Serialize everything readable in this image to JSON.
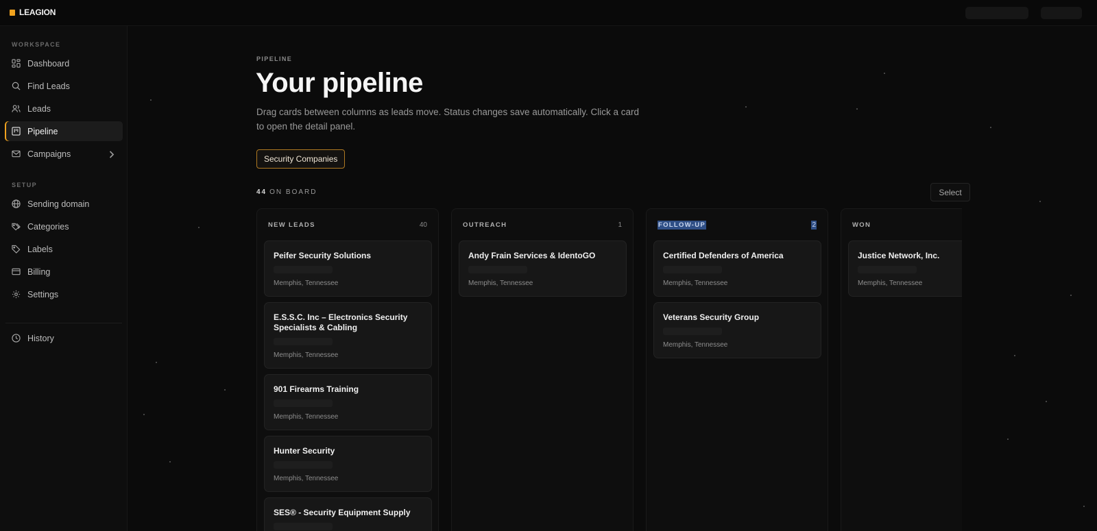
{
  "app": {
    "name": "LEAGION"
  },
  "sidebar": {
    "sections": [
      {
        "label": "WORKSPACE"
      },
      {
        "label": "SETUP"
      }
    ],
    "items": [
      {
        "label": "Dashboard",
        "icon": "grid-icon"
      },
      {
        "label": "Find Leads",
        "icon": "search-icon"
      },
      {
        "label": "Leads",
        "icon": "users-icon"
      },
      {
        "label": "Pipeline",
        "icon": "kanban-icon",
        "active": true
      },
      {
        "label": "Campaigns",
        "icon": "mail-icon"
      },
      {
        "label": "Sending domain",
        "icon": "globe-icon"
      },
      {
        "label": "Categories",
        "icon": "tags-icon"
      },
      {
        "label": "Labels",
        "icon": "tag-icon"
      },
      {
        "label": "Billing",
        "icon": "card-icon"
      },
      {
        "label": "Settings",
        "icon": "gear-icon"
      },
      {
        "label": "History",
        "icon": "clock-icon"
      }
    ]
  },
  "page": {
    "eyebrow": "PIPELINE",
    "title": "Your pipeline",
    "description": "Drag cards between columns as leads move. Status changes save automatically. Click a card to open the detail panel.",
    "filter_label": "Security Companies",
    "board_count": "44",
    "board_count_label": "ON BOARD",
    "select_label": "Select"
  },
  "columns": [
    {
      "title": "NEW LEADS",
      "count": "40",
      "cards": [
        {
          "name": "Peifer Security Solutions",
          "location": "Memphis, Tennessee"
        },
        {
          "name": "E.S.S.C. Inc – Electronics Security Specialists & Cabling",
          "location": "Memphis, Tennessee"
        },
        {
          "name": "901 Firearms Training",
          "location": "Memphis, Tennessee"
        },
        {
          "name": "Hunter Security",
          "location": "Memphis, Tennessee"
        },
        {
          "name": "SES® - Security Equipment Supply",
          "location": ""
        }
      ]
    },
    {
      "title": "OUTREACH",
      "count": "1",
      "cards": [
        {
          "name": "Andy Frain Services & IdentoGO",
          "location": "Memphis, Tennessee"
        }
      ]
    },
    {
      "title": "FOLLOW-UP",
      "count": "2",
      "cards": [
        {
          "name": "Certified Defenders of America",
          "location": "Memphis, Tennessee"
        },
        {
          "name": "Veterans Security Group",
          "location": "Memphis, Tennessee"
        }
      ]
    },
    {
      "title": "WON",
      "count": "",
      "cards": [
        {
          "name": "Justice Network, Inc.",
          "location": "Memphis, Tennessee"
        }
      ]
    }
  ],
  "colors": {
    "accent": "#f0a21e",
    "background": "#0b0b0b",
    "selection": "#2f4f86"
  }
}
